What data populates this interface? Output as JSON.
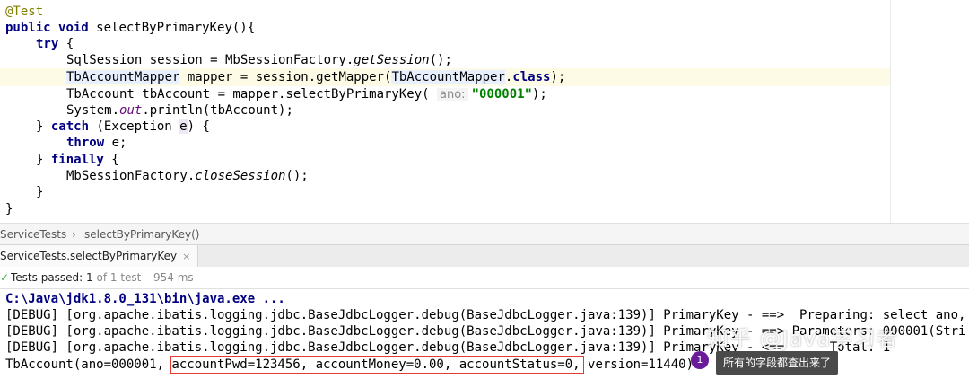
{
  "code": {
    "l1_annotation": "@Test",
    "l2_kw1": "public",
    "l2_kw2": "void",
    "l2_rest": " selectByPrimaryKey(){",
    "l3_kw": "try",
    "l3_rest": " {",
    "l4_a": "SqlSession session = MbSessionFactory.",
    "l4_method": "getSession",
    "l4_b": "();",
    "l5_var": "TbAccountMapper",
    "l5_a": " mapper = session.getMapper(",
    "l5_cls1": "TbAccount",
    "l5_cls2": "Mapper",
    "l5_dot": ".",
    "l5_kw": "class",
    "l5_b": ");",
    "l6_a": "TbAccount tbAccount = mapper.selectByPrimaryKey( ",
    "l6_hint": "ano:",
    "l6_str": "\"000001\"",
    "l6_b": ");",
    "l7_a": "System.",
    "l7_field": "out",
    "l7_b": ".println(tbAccount);",
    "l8_a": "} ",
    "l8_kw": "catch",
    "l8_b": " (Exception ",
    "l8_e": "e",
    "l8_c": ") {",
    "l9_kw": "throw",
    "l9_rest": " e;",
    "l10_a": "} ",
    "l10_kw": "finally",
    "l10_b": " {",
    "l11_a": "MbSessionFactory.",
    "l11_method": "closeSession",
    "l11_b": "();",
    "l12": "}",
    "l13": "}"
  },
  "breadcrumb": {
    "class_name": "ServiceTests",
    "separator": "›",
    "method_name": "selectByPrimaryKey()"
  },
  "run_tab": {
    "label": "ServiceTests.selectByPrimaryKey",
    "close": "×"
  },
  "status": {
    "check": "✓",
    "prefix": "Tests passed: ",
    "passed": "1",
    "suffix": " of 1 test – 954 ms"
  },
  "console": {
    "cmd": "C:\\Java\\jdk1.8.0_131\\bin\\java.exe ...",
    "debug1": "[DEBUG] [org.apache.ibatis.logging.jdbc.BaseJdbcLogger.debug(BaseJdbcLogger.java:139)] PrimaryKey - ==>  Preparing: select ano,",
    "debug2": "[DEBUG] [org.apache.ibatis.logging.jdbc.BaseJdbcLogger.debug(BaseJdbcLogger.java:139)] PrimaryKey - ==> Parameters: 000001(Stri",
    "debug3": "[DEBUG] [org.apache.ibatis.logging.jdbc.BaseJdbcLogger.debug(BaseJdbcLogger.java:139)] PrimaryKey - <==      Total: 1",
    "result": "TbAccount(ano=000001, accountPwd=123456, accountMoney=0.00, accountStatus=0, version=11440)"
  },
  "overlay": {
    "watermark": "知乎 @Java学习者",
    "badge": "1",
    "tooltip": "所有的字段都查出来了"
  },
  "colors": {
    "keyword": "#000080",
    "annotation": "#808000",
    "string": "#008000",
    "static_field": "#660e7a",
    "highlight_box": "#e53935",
    "badge": "#6a1b9a"
  }
}
